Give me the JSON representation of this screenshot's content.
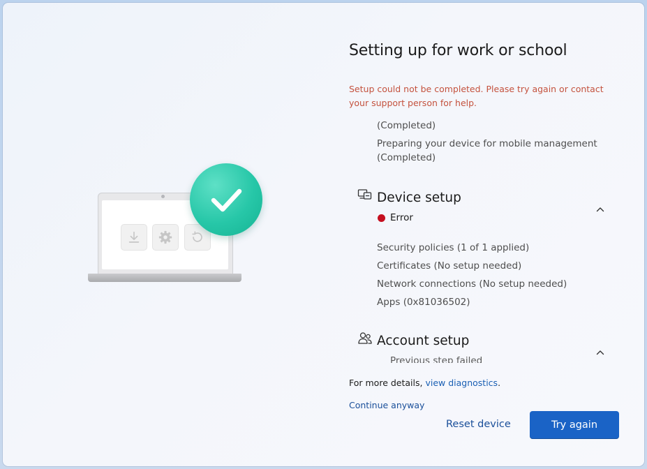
{
  "title": "Setting up for work or school",
  "error_message": "Setup could not be completed. Please try again or contact your support person for help.",
  "previous_items": [
    "(Completed)",
    "Preparing your device for mobile management",
    "(Completed)"
  ],
  "device_setup": {
    "title": "Device setup",
    "status": "Error",
    "items": [
      "Security policies (1 of 1 applied)",
      "Certificates (No setup needed)",
      "Network connections (No setup needed)",
      "Apps (0x81036502)"
    ]
  },
  "account_setup": {
    "title": "Account setup",
    "status": "Previous step failed"
  },
  "details_prefix": "For more details,",
  "details_link": "view diagnostics",
  "details_suffix": ".",
  "continue_link": "Continue anyway",
  "reset_button": "Reset device",
  "try_again_button": "Try again",
  "colors": {
    "accent": "#1a63c6",
    "error_text": "#c4523e",
    "error_dot": "#c50f1f",
    "check_badge": "#27c7a8"
  },
  "icons": {
    "device_setup": "device-setup-icon",
    "account_setup": "account-setup-icon",
    "chevron": "chevron-up-icon",
    "badge": "checkmark-icon"
  }
}
